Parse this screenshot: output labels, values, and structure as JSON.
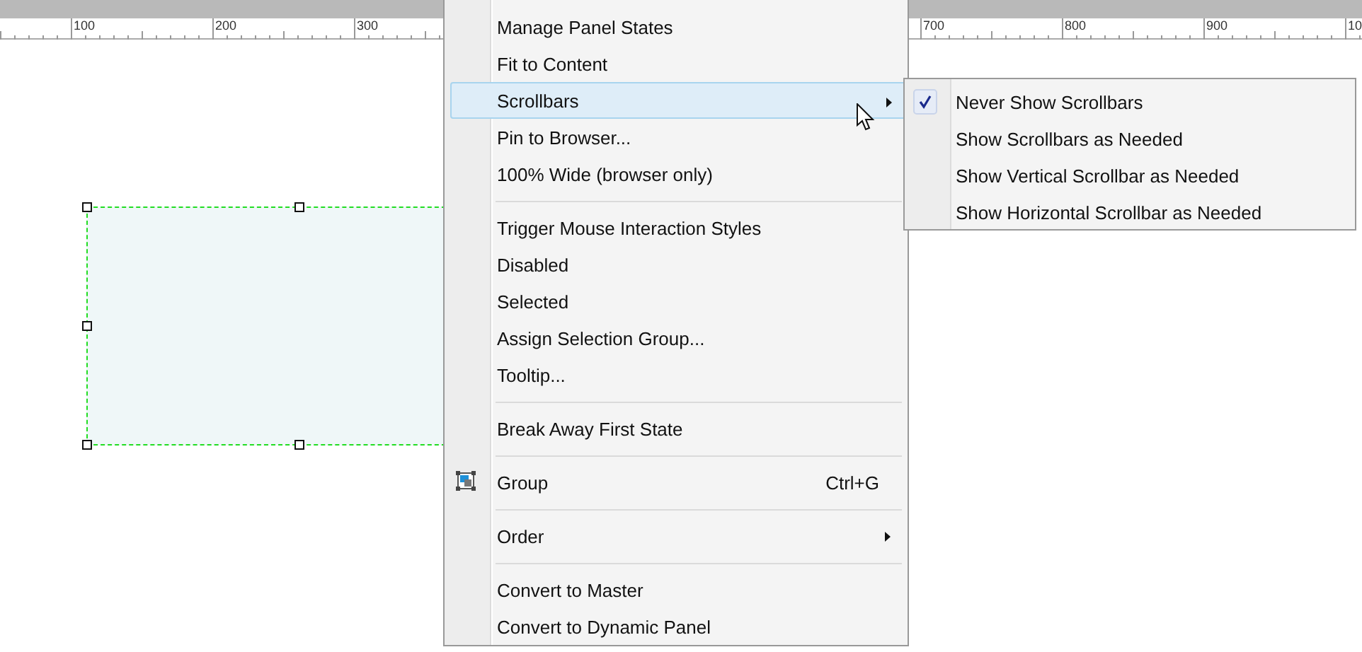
{
  "ruler": {
    "labels": [
      "100",
      "200",
      "300",
      "700",
      "800",
      "900",
      "10"
    ]
  },
  "context_menu": {
    "items": [
      {
        "kind": "command",
        "label": "Manage Panel States",
        "highlighted": false
      },
      {
        "kind": "command",
        "label": "Fit to Content",
        "highlighted": false
      },
      {
        "kind": "submenu",
        "label": "Scrollbars",
        "highlighted": true
      },
      {
        "kind": "command",
        "label": "Pin to Browser...",
        "highlighted": false
      },
      {
        "kind": "command",
        "label": "100% Wide (browser only)",
        "highlighted": false
      },
      {
        "kind": "separator"
      },
      {
        "kind": "command",
        "label": "Trigger Mouse Interaction Styles",
        "highlighted": false
      },
      {
        "kind": "command",
        "label": "Disabled",
        "highlighted": false
      },
      {
        "kind": "command",
        "label": "Selected",
        "highlighted": false
      },
      {
        "kind": "command",
        "label": "Assign Selection Group...",
        "highlighted": false
      },
      {
        "kind": "command",
        "label": "Tooltip...",
        "highlighted": false
      },
      {
        "kind": "separator"
      },
      {
        "kind": "command",
        "label": "Break Away First State",
        "highlighted": false
      },
      {
        "kind": "separator"
      },
      {
        "kind": "group",
        "label": "Group",
        "shortcut": "Ctrl+G",
        "highlighted": false
      },
      {
        "kind": "separator"
      },
      {
        "kind": "submenu",
        "label": "Order",
        "highlighted": false
      },
      {
        "kind": "separator"
      },
      {
        "kind": "command",
        "label": "Convert to Master",
        "highlighted": false
      },
      {
        "kind": "command",
        "label": "Convert to Dynamic Panel",
        "highlighted": false
      }
    ]
  },
  "submenu": {
    "items": [
      {
        "label": "Never Show Scrollbars",
        "checked": true
      },
      {
        "label": "Show Scrollbars as Needed",
        "checked": false
      },
      {
        "label": "Show Vertical Scrollbar as Needed",
        "checked": false
      },
      {
        "label": "Show Horizontal Scrollbar as Needed",
        "checked": false
      }
    ]
  }
}
